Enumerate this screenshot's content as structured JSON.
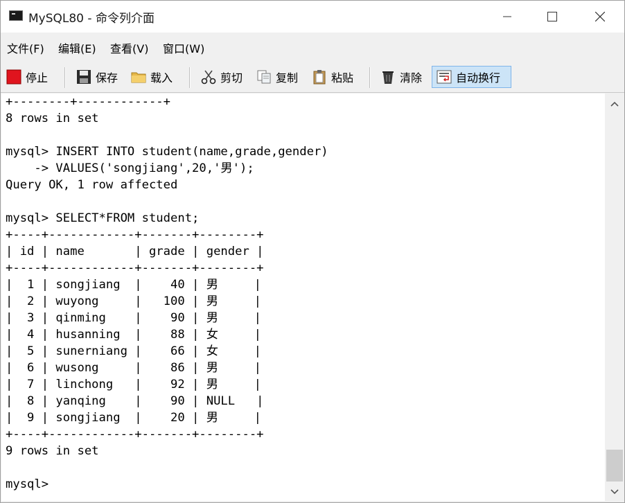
{
  "window": {
    "title": "MySQL80 - 命令列介面",
    "app_icon": "console-icon",
    "controls": [
      "minimize-icon",
      "maximize-icon",
      "close-icon"
    ]
  },
  "menu": {
    "items": [
      "文件(F)",
      "编辑(E)",
      "查看(V)",
      "窗口(W)"
    ]
  },
  "toolbar": {
    "stop": {
      "label": "停止",
      "icon": "stop-icon",
      "color": "#e0141e"
    },
    "save": {
      "label": "保存",
      "icon": "floppy-icon"
    },
    "load": {
      "label": "载入",
      "icon": "folder-icon"
    },
    "cut": {
      "label": "剪切",
      "icon": "scissors-icon"
    },
    "copy": {
      "label": "复制",
      "icon": "copy-icon"
    },
    "paste": {
      "label": "粘贴",
      "icon": "clipboard-icon"
    },
    "clear": {
      "label": "清除",
      "icon": "trash-icon"
    },
    "wrap": {
      "label": "自动换行",
      "icon": "wrap-icon",
      "active": true
    }
  },
  "console": {
    "lines": [
      "+--------+------------+",
      "8 rows in set",
      "",
      "mysql> INSERT INTO student(name,grade,gender)",
      "    -> VALUES('songjiang',20,'男');",
      "Query OK, 1 row affected",
      "",
      "mysql> SELECT*FROM student;",
      "+----+------------+-------+--------+",
      "| id | name       | grade | gender |",
      "+----+------------+-------+--------+",
      "|  1 | songjiang  |    40 | 男     |",
      "|  2 | wuyong     |   100 | 男     |",
      "|  3 | qinming    |    90 | 男     |",
      "|  4 | husanning  |    88 | 女     |",
      "|  5 | sunerniang |    66 | 女     |",
      "|  6 | wusong     |    86 | 男     |",
      "|  7 | linchong   |    92 | 男     |",
      "|  8 | yanqing    |    90 | NULL   |",
      "|  9 | songjiang  |    20 | 男     |",
      "+----+------------+-------+--------+",
      "9 rows in set",
      "",
      "mysql> "
    ]
  },
  "scrollbar": {
    "up_icon": "chevron-up-icon",
    "down_icon": "chevron-down-icon",
    "position": 1.0
  }
}
